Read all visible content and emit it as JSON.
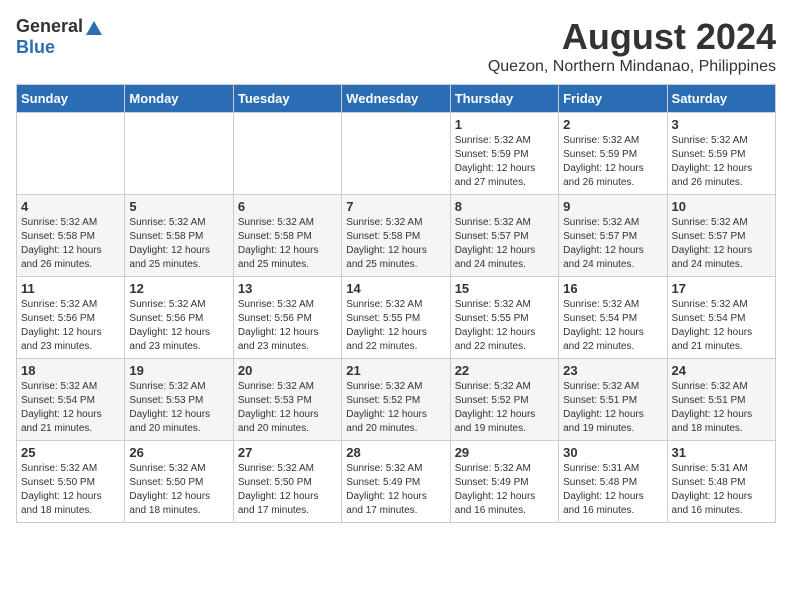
{
  "header": {
    "logo_general": "General",
    "logo_blue": "Blue",
    "title": "August 2024",
    "location": "Quezon, Northern Mindanao, Philippines"
  },
  "days_of_week": [
    "Sunday",
    "Monday",
    "Tuesday",
    "Wednesday",
    "Thursday",
    "Friday",
    "Saturday"
  ],
  "weeks": [
    [
      {
        "day": "",
        "info": ""
      },
      {
        "day": "",
        "info": ""
      },
      {
        "day": "",
        "info": ""
      },
      {
        "day": "",
        "info": ""
      },
      {
        "day": "1",
        "info": "Sunrise: 5:32 AM\nSunset: 5:59 PM\nDaylight: 12 hours and 27 minutes."
      },
      {
        "day": "2",
        "info": "Sunrise: 5:32 AM\nSunset: 5:59 PM\nDaylight: 12 hours and 26 minutes."
      },
      {
        "day": "3",
        "info": "Sunrise: 5:32 AM\nSunset: 5:59 PM\nDaylight: 12 hours and 26 minutes."
      }
    ],
    [
      {
        "day": "4",
        "info": "Sunrise: 5:32 AM\nSunset: 5:58 PM\nDaylight: 12 hours and 26 minutes."
      },
      {
        "day": "5",
        "info": "Sunrise: 5:32 AM\nSunset: 5:58 PM\nDaylight: 12 hours and 25 minutes."
      },
      {
        "day": "6",
        "info": "Sunrise: 5:32 AM\nSunset: 5:58 PM\nDaylight: 12 hours and 25 minutes."
      },
      {
        "day": "7",
        "info": "Sunrise: 5:32 AM\nSunset: 5:58 PM\nDaylight: 12 hours and 25 minutes."
      },
      {
        "day": "8",
        "info": "Sunrise: 5:32 AM\nSunset: 5:57 PM\nDaylight: 12 hours and 24 minutes."
      },
      {
        "day": "9",
        "info": "Sunrise: 5:32 AM\nSunset: 5:57 PM\nDaylight: 12 hours and 24 minutes."
      },
      {
        "day": "10",
        "info": "Sunrise: 5:32 AM\nSunset: 5:57 PM\nDaylight: 12 hours and 24 minutes."
      }
    ],
    [
      {
        "day": "11",
        "info": "Sunrise: 5:32 AM\nSunset: 5:56 PM\nDaylight: 12 hours and 23 minutes."
      },
      {
        "day": "12",
        "info": "Sunrise: 5:32 AM\nSunset: 5:56 PM\nDaylight: 12 hours and 23 minutes."
      },
      {
        "day": "13",
        "info": "Sunrise: 5:32 AM\nSunset: 5:56 PM\nDaylight: 12 hours and 23 minutes."
      },
      {
        "day": "14",
        "info": "Sunrise: 5:32 AM\nSunset: 5:55 PM\nDaylight: 12 hours and 22 minutes."
      },
      {
        "day": "15",
        "info": "Sunrise: 5:32 AM\nSunset: 5:55 PM\nDaylight: 12 hours and 22 minutes."
      },
      {
        "day": "16",
        "info": "Sunrise: 5:32 AM\nSunset: 5:54 PM\nDaylight: 12 hours and 22 minutes."
      },
      {
        "day": "17",
        "info": "Sunrise: 5:32 AM\nSunset: 5:54 PM\nDaylight: 12 hours and 21 minutes."
      }
    ],
    [
      {
        "day": "18",
        "info": "Sunrise: 5:32 AM\nSunset: 5:54 PM\nDaylight: 12 hours and 21 minutes."
      },
      {
        "day": "19",
        "info": "Sunrise: 5:32 AM\nSunset: 5:53 PM\nDaylight: 12 hours and 20 minutes."
      },
      {
        "day": "20",
        "info": "Sunrise: 5:32 AM\nSunset: 5:53 PM\nDaylight: 12 hours and 20 minutes."
      },
      {
        "day": "21",
        "info": "Sunrise: 5:32 AM\nSunset: 5:52 PM\nDaylight: 12 hours and 20 minutes."
      },
      {
        "day": "22",
        "info": "Sunrise: 5:32 AM\nSunset: 5:52 PM\nDaylight: 12 hours and 19 minutes."
      },
      {
        "day": "23",
        "info": "Sunrise: 5:32 AM\nSunset: 5:51 PM\nDaylight: 12 hours and 19 minutes."
      },
      {
        "day": "24",
        "info": "Sunrise: 5:32 AM\nSunset: 5:51 PM\nDaylight: 12 hours and 18 minutes."
      }
    ],
    [
      {
        "day": "25",
        "info": "Sunrise: 5:32 AM\nSunset: 5:50 PM\nDaylight: 12 hours and 18 minutes."
      },
      {
        "day": "26",
        "info": "Sunrise: 5:32 AM\nSunset: 5:50 PM\nDaylight: 12 hours and 18 minutes."
      },
      {
        "day": "27",
        "info": "Sunrise: 5:32 AM\nSunset: 5:50 PM\nDaylight: 12 hours and 17 minutes."
      },
      {
        "day": "28",
        "info": "Sunrise: 5:32 AM\nSunset: 5:49 PM\nDaylight: 12 hours and 17 minutes."
      },
      {
        "day": "29",
        "info": "Sunrise: 5:32 AM\nSunset: 5:49 PM\nDaylight: 12 hours and 16 minutes."
      },
      {
        "day": "30",
        "info": "Sunrise: 5:31 AM\nSunset: 5:48 PM\nDaylight: 12 hours and 16 minutes."
      },
      {
        "day": "31",
        "info": "Sunrise: 5:31 AM\nSunset: 5:48 PM\nDaylight: 12 hours and 16 minutes."
      }
    ]
  ]
}
